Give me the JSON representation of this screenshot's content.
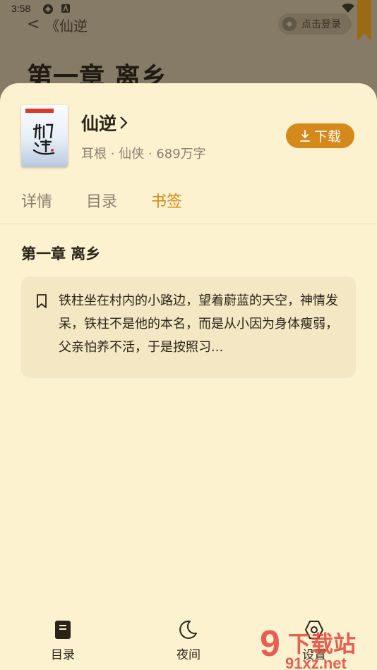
{
  "status_bar": {
    "time": "3:58"
  },
  "top_bar": {
    "back": "<",
    "title": "《仙逆",
    "login_label": "点击登录"
  },
  "background_page": {
    "chapter_title": "第一章 离乡"
  },
  "sheet": {
    "book": {
      "title": "仙逆",
      "meta": "耳根 · 仙侠 · 689万字",
      "download_label": "下载"
    },
    "tabs": [
      {
        "label": "详情",
        "active": false
      },
      {
        "label": "目录",
        "active": false
      },
      {
        "label": "书签",
        "active": true
      }
    ],
    "bookmark": {
      "chapter": "第一章 离乡",
      "excerpt": "铁柱坐在村内的小路边，望着蔚蓝的天空，神情发呆，铁柱不是他的本名，而是从小因为身体瘦弱，父亲怕养不活，于是按照习..."
    }
  },
  "bottom_nav": {
    "items": [
      {
        "label": "目录",
        "icon": "book-icon"
      },
      {
        "label": "夜间",
        "icon": "moon-icon"
      },
      {
        "label": "设置",
        "icon": "settings-icon"
      }
    ]
  },
  "watermark": {
    "text": "9 下载站",
    "sub": "91xz.net"
  },
  "colors": {
    "accent": "#d4891a",
    "sheet": "#fdf2d0",
    "card": "#f4e7c3"
  }
}
